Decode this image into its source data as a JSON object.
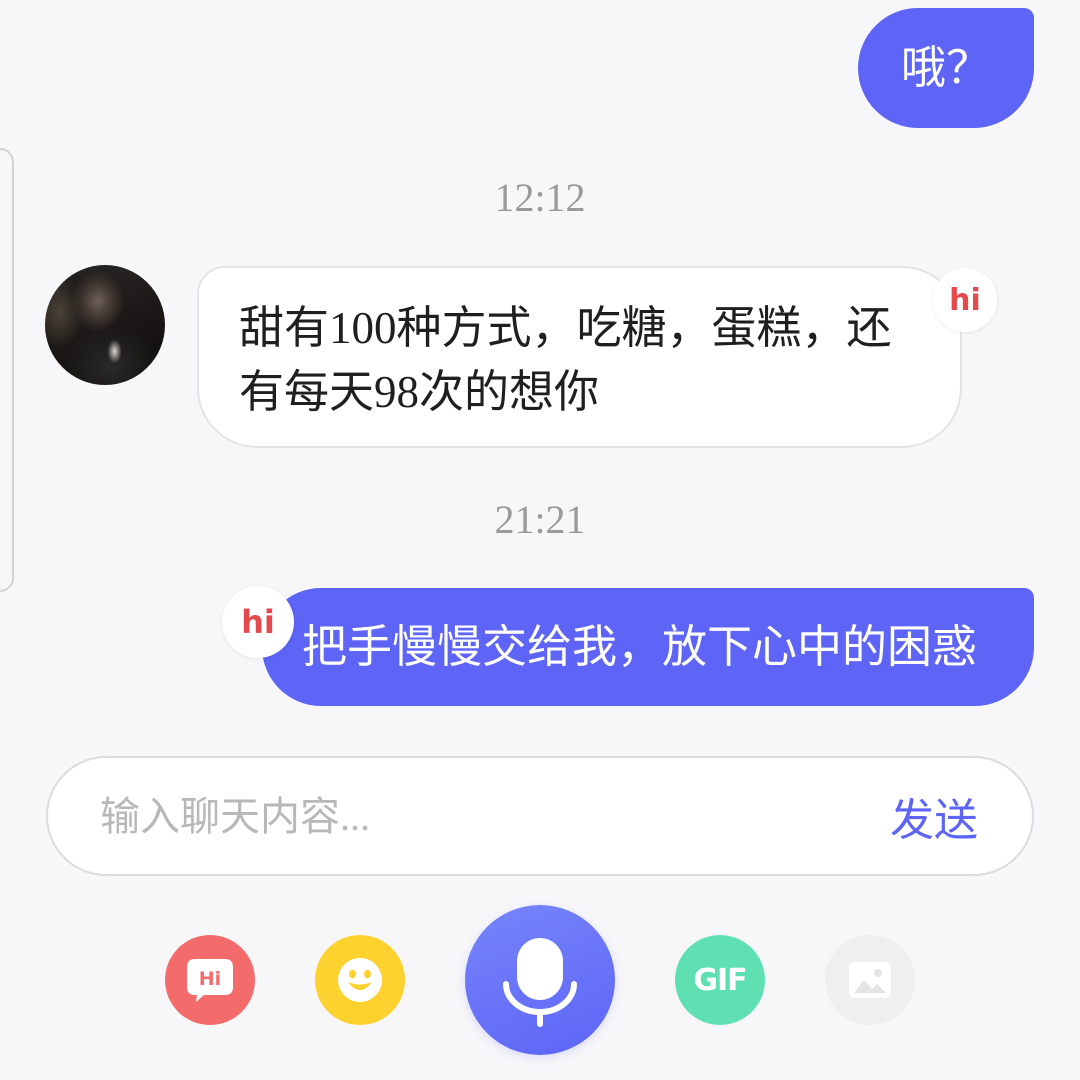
{
  "theme": {
    "background": "#f7f7f9",
    "accent": "#5d64f6",
    "bubble_in": "#ffffff",
    "bubble_in_border": "#e4e4e6",
    "badge_text": "#e5484d",
    "timestamp": "#9a9a9a",
    "placeholder": "#b8b8b8",
    "text": "#1f1f1f"
  },
  "chat": {
    "outgoing_1": {
      "text": "哦？"
    },
    "time_1": "12:12",
    "incoming_1": {
      "text": "甜有100种方式，吃糖，蛋糕，还有每天98次的想你",
      "badge": "hi"
    },
    "time_2": "21:21",
    "outgoing_2": {
      "text": "把手慢慢交给我，放下心中的困惑",
      "badge": "hi"
    }
  },
  "composer": {
    "placeholder": "输入聊天内容...",
    "send_label": "发送"
  },
  "toolbar": {
    "hi_sticker": {
      "icon": "hi-bubble-icon",
      "label": "Hi",
      "color": "#f46b6b"
    },
    "emoji": {
      "icon": "smiley-icon",
      "color": "#fdd12e"
    },
    "voice": {
      "icon": "microphone-icon",
      "color": "#5d64f6"
    },
    "gif": {
      "icon": "gif-icon",
      "label": "GIF",
      "color": "#5fe0b3"
    },
    "image": {
      "icon": "image-icon",
      "color": "#efefef"
    }
  }
}
